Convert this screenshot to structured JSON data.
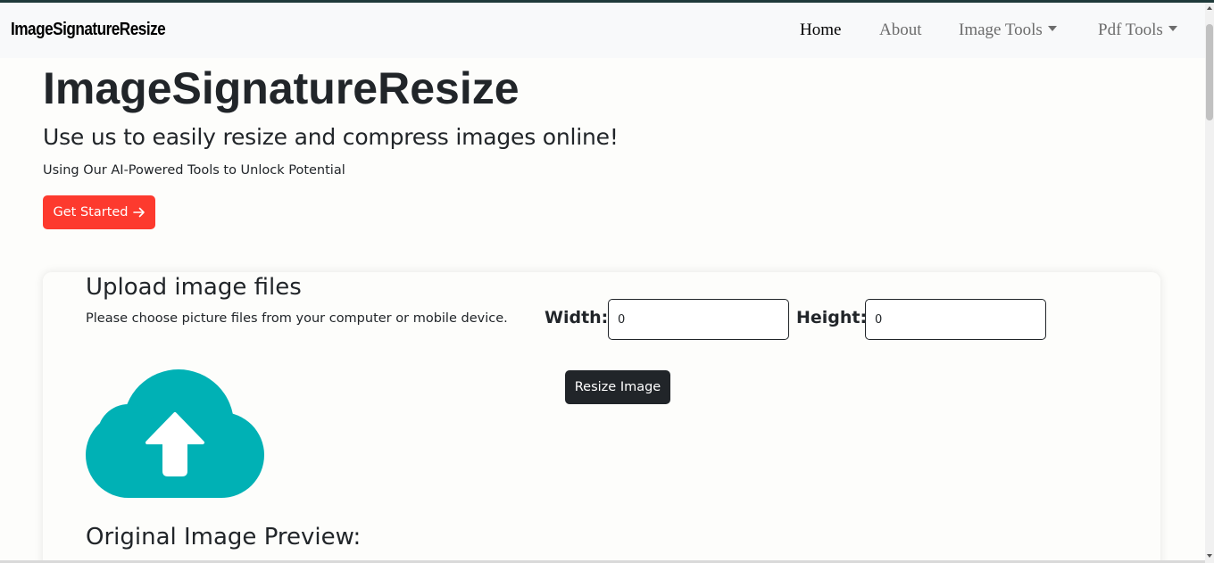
{
  "navbar": {
    "brand": "ImageSignatureResize",
    "items": [
      {
        "label": "Home",
        "active": true
      },
      {
        "label": "About"
      },
      {
        "label": "Image Tools",
        "dropdown": true
      },
      {
        "label": "Pdf Tools",
        "dropdown": true
      }
    ]
  },
  "hero": {
    "title": "ImageSignatureResize",
    "subtitle": "Use us to easily resize and compress images online!",
    "text": "Using Our AI-Powered Tools to Unlock Potential",
    "cta_label": "Get Started",
    "cta_icon": "arrow-right-icon"
  },
  "upload": {
    "title": "Upload image files",
    "description": "Please choose picture files from your computer or mobile device.",
    "width_label": "Width:",
    "width_value": "0",
    "height_label": "Height:",
    "height_value": "0",
    "resize_label": "Resize Image",
    "upload_icon": "cloud-upload-icon",
    "preview_title": "Original Image Preview:"
  },
  "colors": {
    "primary_button": "#fd3a2e",
    "dark_button": "#212529",
    "upload_icon": "#00b1b5",
    "navbar_bg": "#f8f9fa"
  }
}
